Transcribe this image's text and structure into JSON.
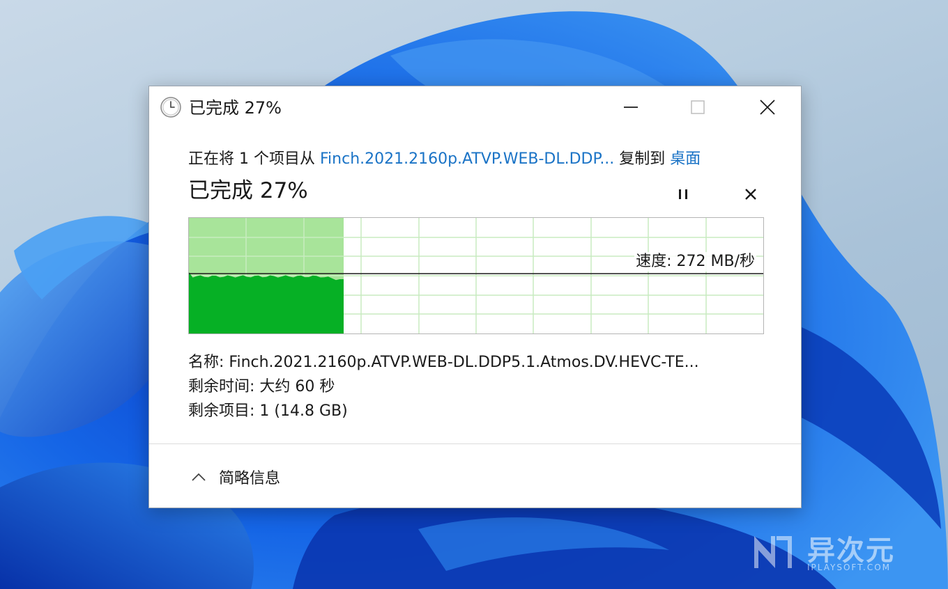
{
  "window": {
    "title": "已完成 27%",
    "minimize_label": "—",
    "maximize_label": "□",
    "close_label": "✕"
  },
  "copy": {
    "prefix": "正在将 1 个项目从 ",
    "source": "Finch.2021.2160p.ATVP.WEB-DL.DDP...",
    "middle": " 复制到 ",
    "destination": "桌面"
  },
  "status": {
    "percent_text": "已完成 27%",
    "progress_percent": 27,
    "pause_icon": "pause-icon",
    "cancel_icon": "close-icon"
  },
  "graph": {
    "speed_label": "速度: 272 MB/秒",
    "current_speed_fraction": 0.52,
    "colors": {
      "fill": "#06b025",
      "background_fill": "#a8e49a",
      "grid": "#c8ebc0",
      "line": "#1a1a1a"
    }
  },
  "details": {
    "name_label": "名称: ",
    "name_value": "Finch.2021.2160p.ATVP.WEB-DL.DDP5.1.Atmos.DV.HEVC-TE...",
    "time_label": "剩余时间: ",
    "time_value": "大约 60 秒",
    "items_label": "剩余项目: ",
    "items_value": "1 (14.8 GB)"
  },
  "footer": {
    "toggle_label": "简略信息",
    "toggle_icon": "chevron-up-icon"
  },
  "watermark": {
    "text": "异次元",
    "subtext": "IPLAYSOFT.COM"
  }
}
